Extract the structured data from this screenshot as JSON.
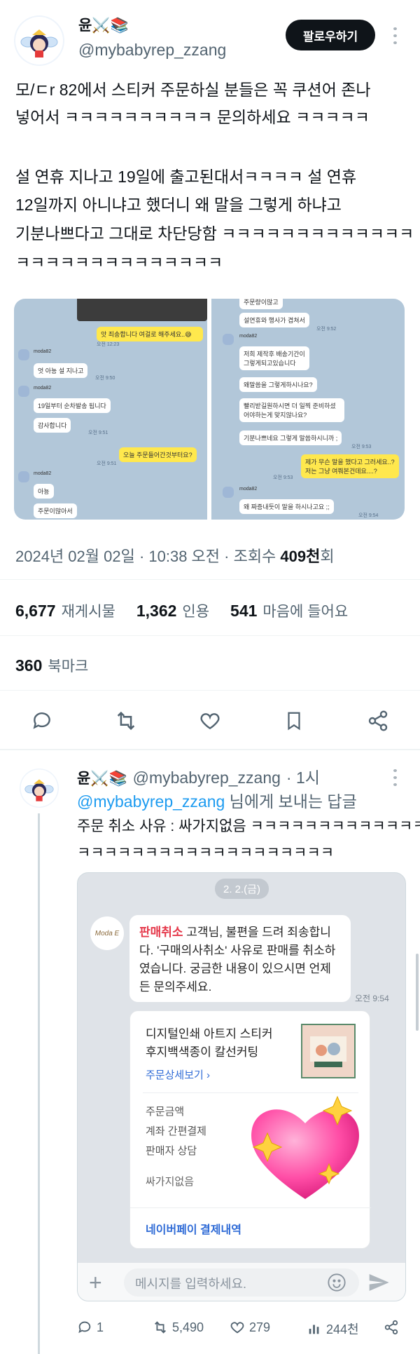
{
  "tweet": {
    "author_name": "윤⚔️📚",
    "author_handle": "@mybabyrep_zzang",
    "follow_label": "팔로우하기",
    "text_line1": "모/ㄷr 82에서 스티커 주문하실 분들은 꼭 쿠션어 존나",
    "text_line2": "넣어서 ㅋㅋㅋㅋㅋㅋㅋㅋㅋㅋ 문의하세요 ㅋㅋㅋㅋㅋ",
    "text_line3": "설 연휴 지나고 19일에 출고된대서ㅋㅋㅋㅋ 설 연휴",
    "text_line4": "12일까지 아니냐고 했더니 왜 말을 그렇게 하냐고",
    "text_line5": "기분나쁘다고 그대로 차단당함 ㅋㅋㅋㅋㅋㅋㅋㅋㅋㅋㅋㅋㅋ",
    "text_line6": "ㅋㅋㅋㅋㅋㅋㅋㅋㅋㅋㅋㅋㅋㅋ",
    "timestamp": "2024년 02월 02일 · 10:38 오전 · 조회수 ",
    "views": "409천",
    "views_suffix": "회",
    "retweets_num": "6,677",
    "retweets_label": "재게시물",
    "quotes_num": "1,362",
    "quotes_label": "인용",
    "likes_num": "541",
    "likes_label": "마음에 들어요",
    "bookmarks_num": "360",
    "bookmarks_label": "북마크"
  },
  "media_left": {
    "msg1": "앗 죄송합니다 여걸로 해주세요..😅",
    "time1": "오전 12:23",
    "user1": "moda82",
    "msg2": "엇 아뇽 설 지나고",
    "time2": "오전 9:50",
    "user2": "moda82",
    "msg3": "19일부터 순차발송 됩니다",
    "msg4": "감사합니다",
    "time3": "오전 9:51",
    "msg5": "오늘 주문들어간것부터요?",
    "time4": "오전 9:51",
    "user3": "moda82",
    "msg6": "아뇽",
    "msg7": "주문이많아서"
  },
  "media_right": {
    "msg0": "주문량이많고",
    "msg1": "설연휴와 행사가 겹쳐서",
    "time1": "오전 9:52",
    "user1": "moda82",
    "msg2": "저희 제작후 배송기간이 그렇게되고있습니다",
    "msg3": "왜말씀을 그렇게하시나요?",
    "msg4": "빨리받길원하시면 더 일찍 준비하셨어야하는게 맞지않나요?",
    "msg5": "기분나쁘네요 그렇게 말씀하시니까 ;",
    "time2": "오전 9:53",
    "msg6": "제가 무슨 말을 했다고 그러세요..? 저는 그냥 여쭤본건데요....?",
    "time3": "오전 9:53",
    "user2": "moda82",
    "msg7": "왜 짜증내듯이 말을 하시나고요 ;;",
    "time4": "오전 9:54"
  },
  "actions": {
    "reply": "reply-icon",
    "retweet": "retweet-icon",
    "like": "heart-icon",
    "bookmark": "bookmark-icon",
    "share": "share-icon"
  },
  "reply": {
    "author_name": "윤⚔️📚",
    "author_handle": "@mybabyrep_zzang",
    "time": "· 1시",
    "replying_to_handle": "@mybabyrep_zzang",
    "replying_to_suffix": " 님에게 보내는 답글",
    "text_line1": "주문 취소 사유 : 싸가지없음 ㅋㅋㅋㅋㅋㅋㅋㅋㅋㅋㅋㅋㅋㅋ",
    "text_line2": "ㅋㅋㅋㅋㅋㅋㅋㅋㅋㅋㅋㅋㅋㅋㅋㅋㅋㅋㅋ",
    "footer_replies": "1",
    "footer_retweets": "5,490",
    "footer_likes": "279",
    "footer_views": "244천"
  },
  "kakao": {
    "date": "2. 2.(금)",
    "logo_text": "Moda E",
    "red_label": "판매취소",
    "message": " 고객님, 불편을 드려 죄송합니다. '구매의사취소' 사유로 판매를 취소하였습니다. 궁금한 내용이 있으시면 언제든 문의주세요.",
    "time": "오전 9:54",
    "product_line1": "디지털인쇄 아트지 스티커",
    "product_line2": "후지백색종이 칼선커팅",
    "detail_link": "주문상세보기",
    "row1": "주문금액",
    "row2": "계좌 간편결제",
    "row3": "판매자 상담",
    "reason": "싸가지없음",
    "npay_link": "네이버페이 결제내역",
    "input_placeholder": "메시지를 입력하세요."
  },
  "colors": {
    "accent": "#1d9bf0",
    "red": "#e5384a",
    "kakao_yellow": "#ffe84d",
    "chat_bg": "#b2c7d9"
  }
}
